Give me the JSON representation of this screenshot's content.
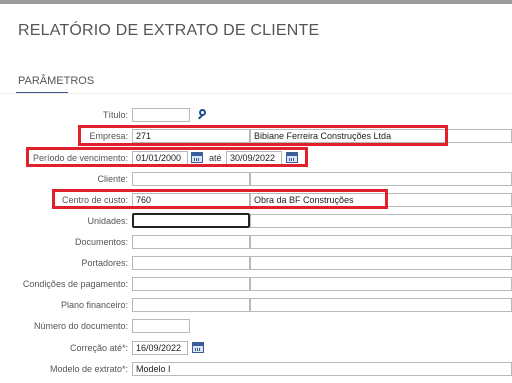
{
  "page": {
    "title": "RELATÓRIO DE EXTRATO DE CLIENTE",
    "section": "PARÂMETROS"
  },
  "form": {
    "titulo": {
      "label": "Título:",
      "value": ""
    },
    "empresa": {
      "label": "Empresa:",
      "code": "271",
      "name": "Bibiane Ferreira Construções Ltda"
    },
    "periodo": {
      "label": "Período de vencimento:",
      "from": "01/01/2000",
      "sep": "até",
      "to": "30/09/2022"
    },
    "cliente": {
      "label": "Cliente:",
      "code": "",
      "name": ""
    },
    "centro": {
      "label": "Centro de custo:",
      "code": "760",
      "name": "Obra da BF Construções"
    },
    "unidades": {
      "label": "Unidades:",
      "code": "",
      "name": ""
    },
    "documentos": {
      "label": "Documentos:",
      "code": "",
      "name": ""
    },
    "portadores": {
      "label": "Portadores:",
      "code": "",
      "name": ""
    },
    "condicoes": {
      "label": "Condições de pagamento:",
      "code": "",
      "name": ""
    },
    "plano": {
      "label": "Plano financeiro:",
      "code": "",
      "name": ""
    },
    "numero": {
      "label": "Número do documento:",
      "value": ""
    },
    "correcao": {
      "label": "Correção até*:",
      "value": "16/09/2022"
    },
    "modelo": {
      "label": "Modelo de extrato*:",
      "value": "Modelo I"
    }
  },
  "icons": {
    "search": "magnifier-icon",
    "calendar": "calendar-icon"
  },
  "colors": {
    "highlight": "#e0202a",
    "accent": "#1f4d8c"
  }
}
